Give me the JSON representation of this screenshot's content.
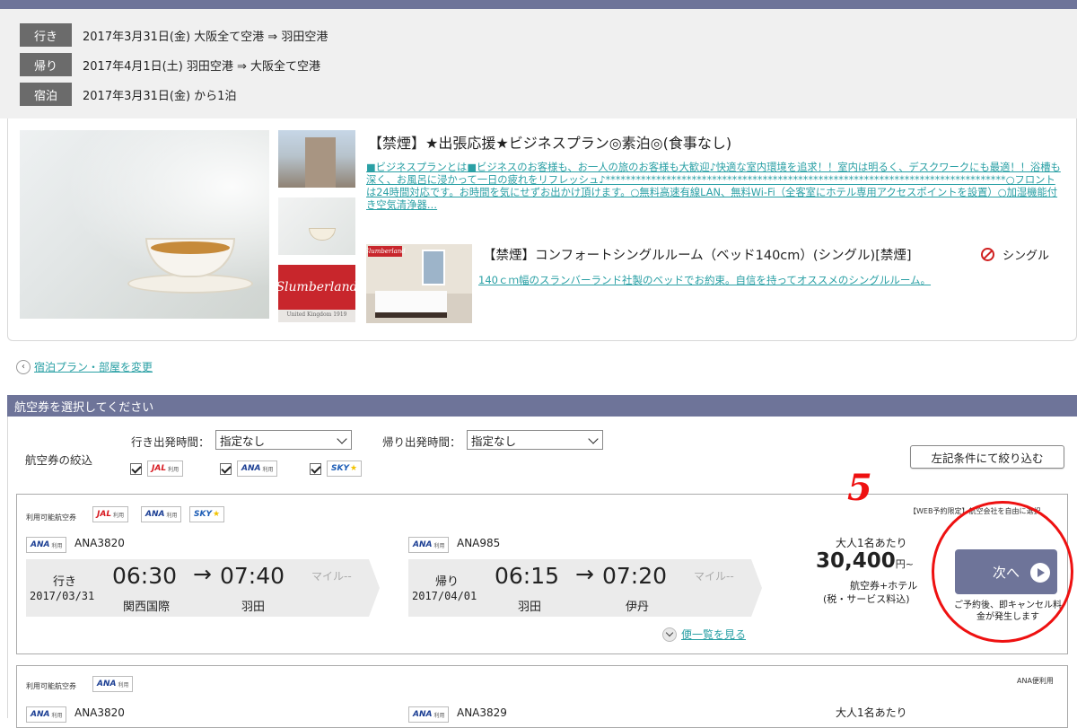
{
  "summary": {
    "rows": [
      {
        "tag": "行き",
        "text": "2017年3月31日(金)  大阪全て空港 ⇒ 羽田空港"
      },
      {
        "tag": "帰り",
        "text": "2017年4月1日(土)  羽田空港 ⇒ 大阪全て空港"
      },
      {
        "tag": "宿泊",
        "text": "2017年3月31日(金) から1泊"
      }
    ]
  },
  "hotel": {
    "plan_title": "【禁煙】★出張応援★ビジネスプラン◎素泊◎(食事なし)",
    "plan_description": "■ビジネスプランとは■ビジネスのお客様も、お一人の旅のお客様も大歓迎♪快適な室内環境を追求！！室内は明るく、デスクワークにも最適！！浴槽も深く、お風呂に浸かって一日の疲れをリフレッシュ♪*******************************************************************************○フロントは24時間対応です。お時間を気にせずお出かけ頂けます。○無料高速有線LAN、無料Wi-Fi（全客室にホテル専用アクセスポイントを設置）○加湿機能付き空気清浄器…",
    "thumb_logo_text": "Slumberland",
    "thumb_logo_sub": "United Kingdom 1919",
    "room_title": "【禁煙】コンフォートシングルルーム（ベッド140cm）(シングル)[禁煙]",
    "room_type": "シングル",
    "room_description": "140ｃｍ幅のスランバーランド社製のベッドでお約束。自信を持ってオススメのシングルルーム。"
  },
  "back_link": "宿泊プラン・部屋を変更",
  "flight_header": "航空券を選択してください",
  "filters": {
    "label": "航空券の絞込",
    "dep_label": "行き出発時間：",
    "dep_value": "指定なし",
    "ret_label": "帰り出発時間：",
    "ret_value": "指定なし",
    "jal": "JAL",
    "ana": "ANA",
    "sky": "SKY",
    "riyou": "利用",
    "narrow_button": "左記条件にて絞り込む"
  },
  "cards": [
    {
      "avail_label": "利用可能航空券",
      "note": "【WEB予約限定】航空会社を自由に選択",
      "outbound": {
        "flight_no": "ANA3820",
        "dir": "行き",
        "date": "2017/03/31",
        "dep_time": "06:30",
        "arr_time": "07:40",
        "dep_airport": "関西国際",
        "arr_airport": "羽田",
        "mile": "マイル--"
      },
      "inbound": {
        "flight_no": "ANA985",
        "dir": "帰り",
        "date": "2017/04/01",
        "dep_time": "06:15",
        "arr_time": "07:20",
        "dep_airport": "羽田",
        "arr_airport": "伊丹",
        "mile": "マイル--"
      },
      "price_caption": "大人1名あたり",
      "price": "30,400",
      "price_unit": "円~",
      "price_sub1": "航空券+ホテル",
      "price_sub2": "(税・サービス料込)",
      "next_button": "次へ",
      "cancel_note": "ご予約後、即キャンセル料金が発生します",
      "more_link": "便一覧を見る"
    },
    {
      "avail_label": "利用可能航空券",
      "note": "ANA便利用",
      "outbound": {
        "flight_no": "ANA3820"
      },
      "inbound": {
        "flight_no": "ANA3829"
      },
      "price_caption": "大人1名あたり"
    }
  ],
  "annotation": {
    "number": "5",
    "color": "#ee1111"
  },
  "colors": {
    "header": "#6e7499",
    "link": "#2aa0a5",
    "tag": "#6b6b6b"
  }
}
